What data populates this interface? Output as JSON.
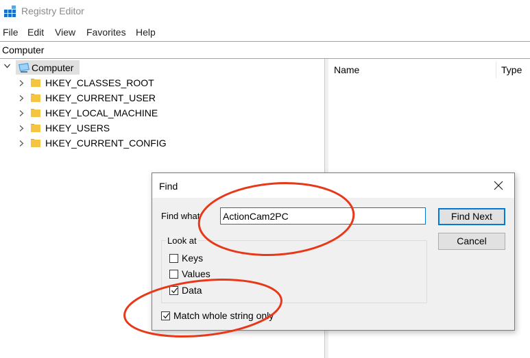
{
  "window": {
    "title": "Registry Editor",
    "icon": "registry-editor-icon"
  },
  "menu": [
    "File",
    "Edit",
    "View",
    "Favorites",
    "Help"
  ],
  "address": "Computer",
  "tree": {
    "root": "Computer",
    "hives": [
      "HKEY_CLASSES_ROOT",
      "HKEY_CURRENT_USER",
      "HKEY_LOCAL_MACHINE",
      "HKEY_USERS",
      "HKEY_CURRENT_CONFIG"
    ]
  },
  "list": {
    "columns": [
      "Name",
      "Type"
    ]
  },
  "find_dialog": {
    "title": "Find",
    "find_what_label": "Find what",
    "find_what_value": "ActionCam2PC",
    "find_next_label": "Find Next",
    "cancel_label": "Cancel",
    "look_at_label": "Look at",
    "options": [
      {
        "label": "Keys",
        "checked": false
      },
      {
        "label": "Values",
        "checked": false
      },
      {
        "label": "Data",
        "checked": true
      }
    ],
    "match_whole_label": "Match whole string only",
    "match_whole_checked": true
  },
  "colors": {
    "accent": "#0078d7",
    "annotation": "#e8381a",
    "selection": "#e0e0e0",
    "folder": "#f4c542"
  }
}
